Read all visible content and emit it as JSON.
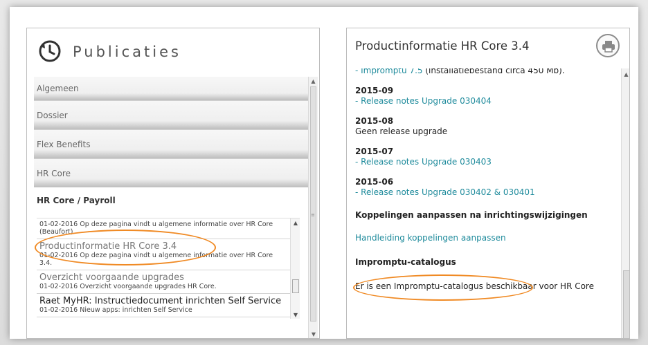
{
  "left": {
    "title": "Publicaties",
    "sections": [
      "Algemeen",
      "Dossier",
      "Flex Benefits",
      "HR Core"
    ],
    "open_section": "HR Core / Payroll",
    "items": [
      {
        "name": "",
        "desc": "01-02-2016 Op deze pagina vindt u algemene informatie over HR Core (Beaufort)."
      },
      {
        "name": "Productinformatie HR Core 3.4",
        "desc": "01-02-2016 Op deze pagina vindt u algemene informatie over HR Core 3.4."
      },
      {
        "name": "Overzicht voorgaande upgrades",
        "desc": "01-02-2016 Overzicht voorgaande upgrades HR Core."
      },
      {
        "name": "Raet MyHR: Instructiedocument inrichten Self Service",
        "desc": "01-02-2016 Nieuw apps: inrichten Self Service"
      }
    ]
  },
  "right": {
    "title": "Productinformatie HR Core 3.4",
    "top_link": "- Impromptu 7.5",
    "top_suffix": " (installatiebestand circa 450 Mb).",
    "y2015_09": "2015-09",
    "l2015_09": "- Release notes Upgrade 030404",
    "y2015_08": "2015-08",
    "p2015_08": "Geen release upgrade",
    "y2015_07": "2015-07",
    "l2015_07": "- Release notes Upgrade 030403",
    "y2015_06": "2015-06",
    "l2015_06": "- Release notes Upgrade 030402 & 030401",
    "koppelingen_heading": "Koppelingen aanpassen na inrichtingswijzigingen",
    "koppelingen_link": "Handleiding koppelingen aanpassen",
    "catalogus_heading": "Impromptu-catalogus",
    "catalogus_text": "Er is een Impromptu-catalogus beschikbaar voor HR Core"
  },
  "colors": {
    "link": "#1f8b9c",
    "highlight": "#f08a24"
  }
}
